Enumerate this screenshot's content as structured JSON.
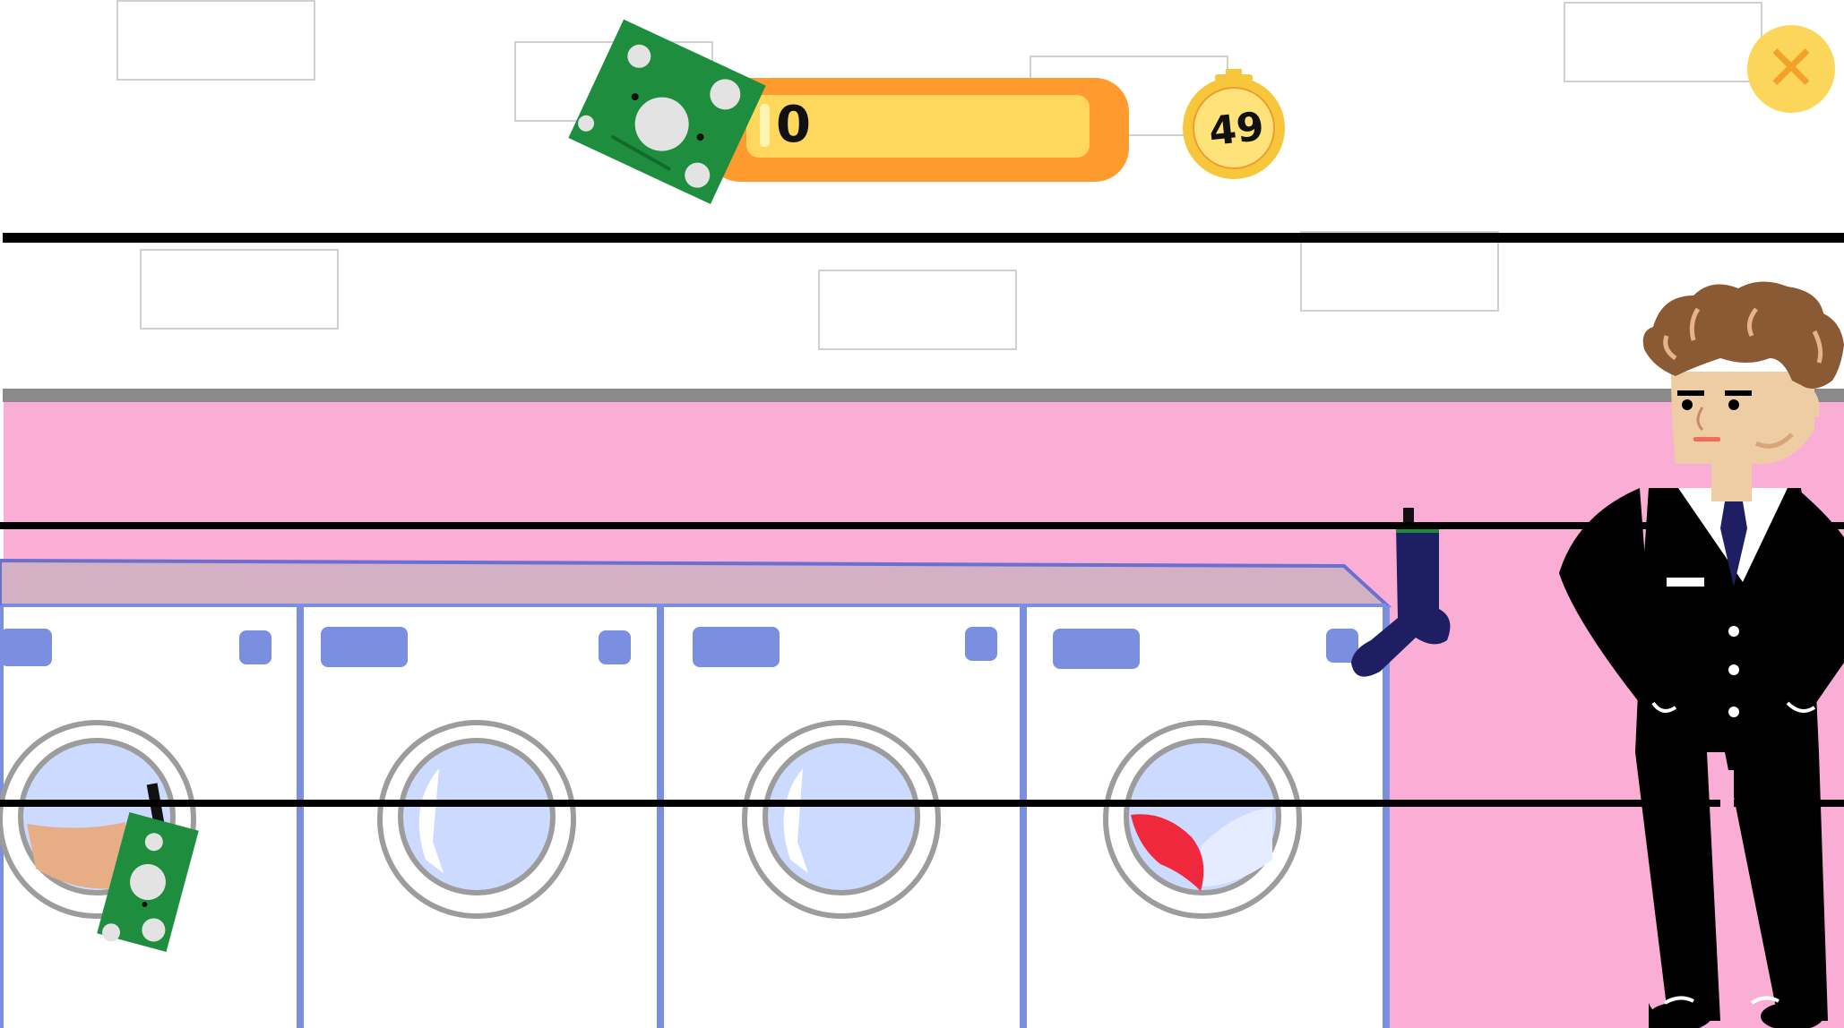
{
  "hud": {
    "score": "0",
    "timer": "49",
    "close_icon": "close-icon",
    "money_icon": "banknote-icon",
    "timer_icon": "stopwatch-icon"
  },
  "scene": {
    "washing_machines": 4,
    "characters": [
      "businessman"
    ],
    "items": [
      "sock",
      "banknote",
      "red-cloth"
    ]
  },
  "colors": {
    "wall_pink": "#fbaed5",
    "wall_white": "#ffffff",
    "machine_outline": "#7b8fe0",
    "banknote_green": "#1e8e3e",
    "score_bar_orange": "#ff9a2e",
    "score_bar_yellow": "#ffd75c",
    "timer_gold": "#f6c73a",
    "close_bg": "#fbd65a",
    "suit_black": "#000000",
    "sock_navy": "#1e1f63"
  }
}
